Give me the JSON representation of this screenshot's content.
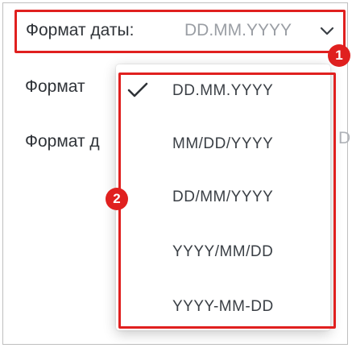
{
  "date_format_field": {
    "label": "Формат даты:",
    "value": "DD.MM.YYYY",
    "chevron_icon": "chevron-down-icon"
  },
  "background_rows": [
    {
      "label": "Формат"
    },
    {
      "label": "Формат д"
    }
  ],
  "background_tail": "D",
  "callouts": {
    "one": "1",
    "two": "2",
    "color": "#e0201f"
  },
  "dropdown": {
    "selected_index": 0,
    "options": [
      "DD.MM.YYYY",
      "MM/DD/YYYY",
      "DD/MM/YYYY",
      "YYYY/MM/DD",
      "YYYY-MM-DD"
    ]
  }
}
